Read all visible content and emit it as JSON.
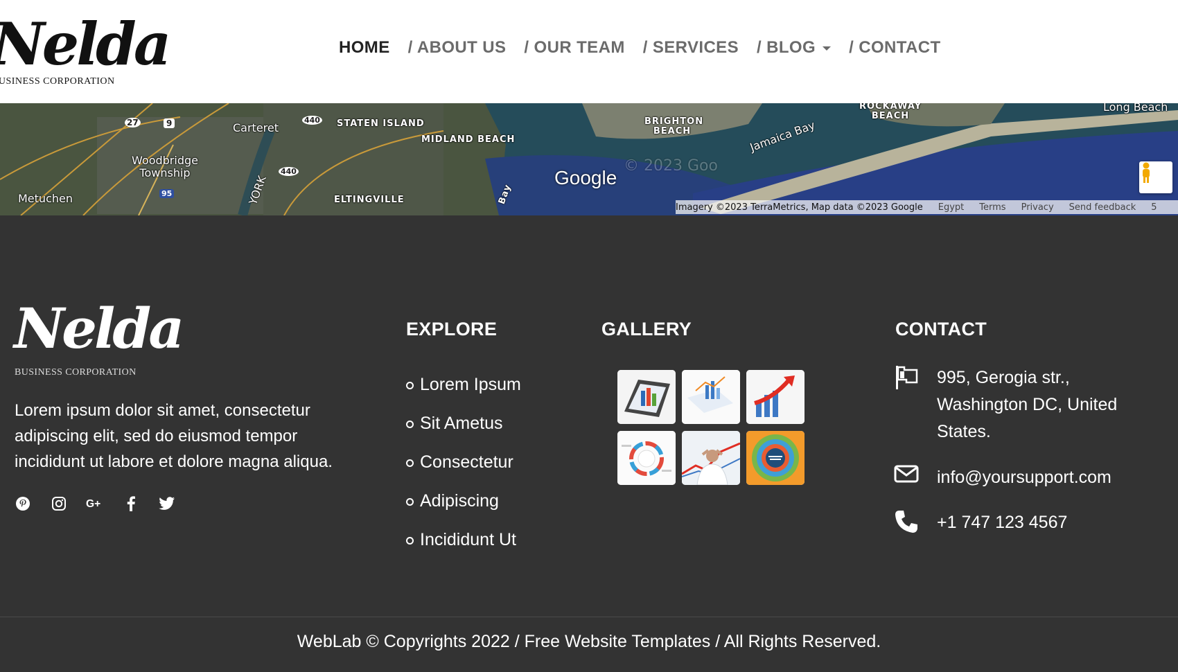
{
  "header": {
    "logo_script": "Nelda",
    "logo_sub": "BUSINESS CORPORATION",
    "nav": [
      "HOME",
      "/ ABOUT US",
      "/ OUR TEAM",
      "/ SERVICES",
      "/ BLOG",
      "/ CONTACT"
    ]
  },
  "map": {
    "labels": [
      "Carteret",
      "STATEN ISLAND",
      "MIDLAND BEACH",
      "BRIGHTON BEACH",
      "Jamaica Bay",
      "ROCKAWAY BEACH",
      "Long Beach",
      "Woodbridge Township",
      "Metuchen",
      "ELTINGVILLE",
      "YORK",
      "Bay"
    ],
    "route_shields": [
      "27",
      "9",
      "440",
      "440",
      "95"
    ],
    "google_logo": "Google",
    "watermark": "© 2023 Goo",
    "attribution": "Imagery ©2023 TerraMetrics, Map data ©2023 Google",
    "links": [
      "Egypt",
      "Terms",
      "Privacy",
      "Send feedback",
      "5"
    ]
  },
  "footer": {
    "logo_script": "Nelda",
    "logo_sub": "BUSINESS CORPORATION",
    "about": "Lorem ipsum dolor sit amet, consectetur adipiscing elit, sed do eiusmod tempor incididunt ut labore et dolore magna aliqua.",
    "social_icons": [
      "pinterest-icon",
      "instagram-icon",
      "google-plus-icon",
      "facebook-icon",
      "twitter-icon"
    ],
    "explore": {
      "title": "EXPLORE",
      "items": [
        "Lorem Ipsum",
        "Sit Ametus",
        "Consectetur",
        "Adipiscing",
        "Incididunt Ut"
      ]
    },
    "gallery": {
      "title": "GALLERY",
      "images": [
        "tablet-chart-thumb",
        "documents-chart-thumb",
        "growth-arrow-thumb",
        "cycle-diagram-thumb",
        "businessman-thumb",
        "circular-infographic-thumb"
      ]
    },
    "contact": {
      "title": "CONTACT",
      "address": "995, Gerogia str., Washington DC, United States.",
      "email": "info@yoursupport.com",
      "phone": "+1 747 123 4567"
    },
    "copyright": {
      "prefix": "WebLab © Copyrights 2022 / ",
      "link": "Free Website Templates",
      "suffix": " / All Rights Reserved."
    }
  },
  "colors": {
    "footer_bg": "#333333",
    "header_bg": "#ffffff",
    "nav_active": "#222222",
    "nav_inactive": "#6b6b6b"
  }
}
